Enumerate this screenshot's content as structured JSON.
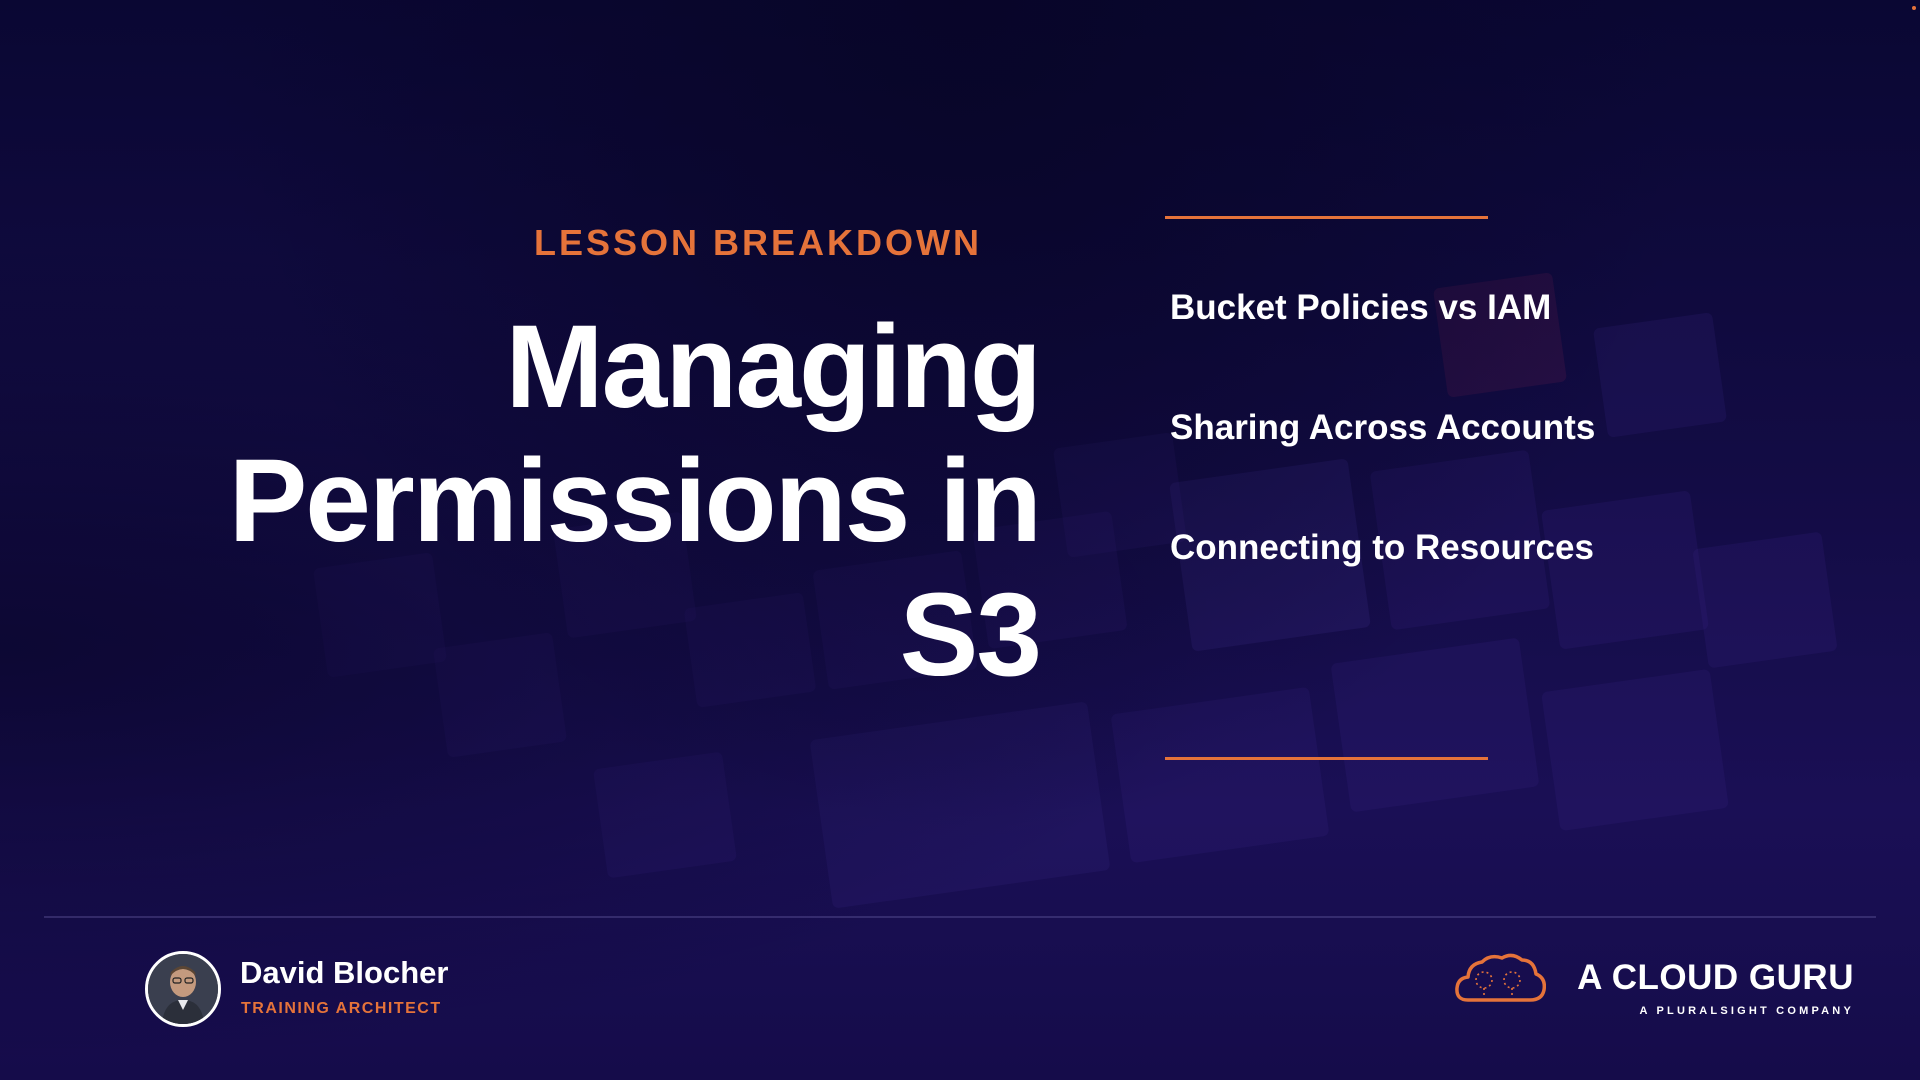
{
  "slide": {
    "eyebrow": "LESSON BREAKDOWN",
    "title_lines": [
      "Managing",
      "Permissions in",
      "S3"
    ],
    "topics": [
      "Bucket Policies vs IAM",
      "Sharing Across Accounts",
      "Connecting to Resources"
    ]
  },
  "presenter": {
    "name": "David Blocher",
    "role": "TRAINING ARCHITECT"
  },
  "brand": {
    "name": "A CLOUD GURU",
    "tagline": "A PLURALSIGHT COMPANY"
  },
  "colors": {
    "accent": "#e5733a",
    "background": "#140c48",
    "text": "#ffffff"
  },
  "icons": {
    "brand_logo": "cloud-guru-cloud-icon",
    "avatar": "presenter-avatar"
  }
}
